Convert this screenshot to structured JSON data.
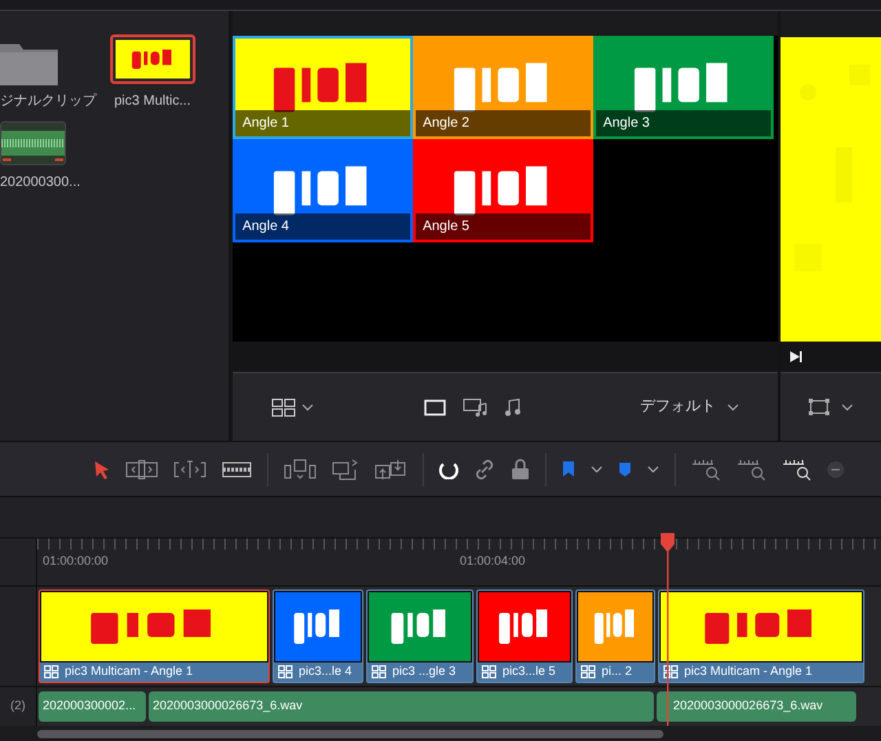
{
  "media_pool": {
    "items": [
      {
        "kind": "folder",
        "label": "ジナルクリップ",
        "selected": false
      },
      {
        "kind": "multicam",
        "label": "pic3 Multic...",
        "selected": true
      },
      {
        "kind": "audio",
        "label": "202000300...",
        "selected": false
      }
    ]
  },
  "viewer": {
    "angles": [
      {
        "label": "Angle 1",
        "color": "#ffff00",
        "selected": true
      },
      {
        "label": "Angle 2",
        "color": "#ff9900",
        "selected": false
      },
      {
        "label": "Angle 3",
        "color": "#009944",
        "selected": false
      },
      {
        "label": "Angle 4",
        "color": "#0066ff",
        "selected": false
      },
      {
        "label": "Angle 5",
        "color": "#ff0000",
        "selected": false
      }
    ]
  },
  "viewer_toolbar": {
    "preset": "デフォルト"
  },
  "timeline": {
    "timecodes": [
      "01:00:00:00",
      "01:00:04:00"
    ],
    "audio_track_label": "(2)",
    "video_clips": [
      {
        "label": "pic3 Multicam - Angle 1",
        "color": "#ffff00",
        "selected": true
      },
      {
        "label": "pic3...le 4",
        "color": "#0066ff",
        "selected": false
      },
      {
        "label": "pic3 ...gle 3",
        "color": "#009944",
        "selected": false
      },
      {
        "label": "pic3...le 5",
        "color": "#ff0000",
        "selected": false
      },
      {
        "label": "pi... 2",
        "color": "#ff9900",
        "selected": false
      },
      {
        "label": "pic3 Multicam - Angle 1",
        "color": "#ffff00",
        "selected": false
      }
    ],
    "audio_clips": [
      {
        "label": "202000300002..."
      },
      {
        "label": "2020003000026673_6.wav"
      },
      {
        "label": "2020003000026673_6.wav"
      }
    ]
  }
}
